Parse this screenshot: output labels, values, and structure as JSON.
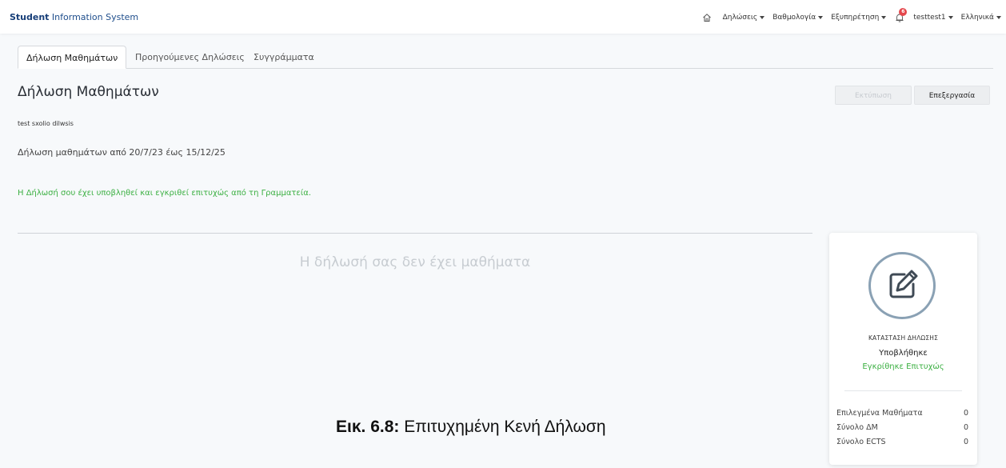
{
  "header": {
    "brand_strong": "Student",
    "brand_rest": " Information System",
    "nav": {
      "declarations": "Δηλώσεις",
      "grades": "Βαθμολογία",
      "service": "Εξυπηρέτηση",
      "notifications_count": "6",
      "user": "testtest1",
      "language": "Ελληνικά"
    }
  },
  "tabs": [
    {
      "label": "Δήλωση Μαθημάτων",
      "active": true
    },
    {
      "label": "Προηγούμενες Δηλώσεις",
      "active": false
    },
    {
      "label": "Συγγράμματα",
      "active": false
    }
  ],
  "main": {
    "title": "Δήλωση Μαθημάτων",
    "print_label": "Εκτύπωση",
    "edit_label": "Επεξεργασία",
    "comment": "test sxolio dilwsis",
    "period": "Δήλωση μαθημάτων από 20/7/23 έως 15/12/25",
    "success_message": "Η Δήλωσή σου έχει υποβληθεί και εγκριθεί επιτυχώς από τη Γραμματεία.",
    "empty_message": "Η δήλωσή σας δεν έχει μαθήματα"
  },
  "status_card": {
    "label": "ΚΑΤΑΣΤΑΣΗ ΔΗΛΩΣΗΣ",
    "status": "Υποβλήθηκε",
    "approval": "Εγκρίθηκε Επιτυχώς",
    "stats": [
      {
        "label": "Επιλεγμένα Μαθήματα",
        "value": "0"
      },
      {
        "label": "Σύνολο ΔΜ",
        "value": "0"
      },
      {
        "label": "Σύνολο ECTS",
        "value": "0"
      }
    ]
  },
  "caption": {
    "prefix": "Εικ. 6.8:",
    "text": " Επιτυχημένη Κενή Δήλωση"
  },
  "colors": {
    "brand": "#1f4e8c",
    "success": "#3cb043",
    "badge": "#e5484d",
    "circle": "#8aa1b4"
  }
}
